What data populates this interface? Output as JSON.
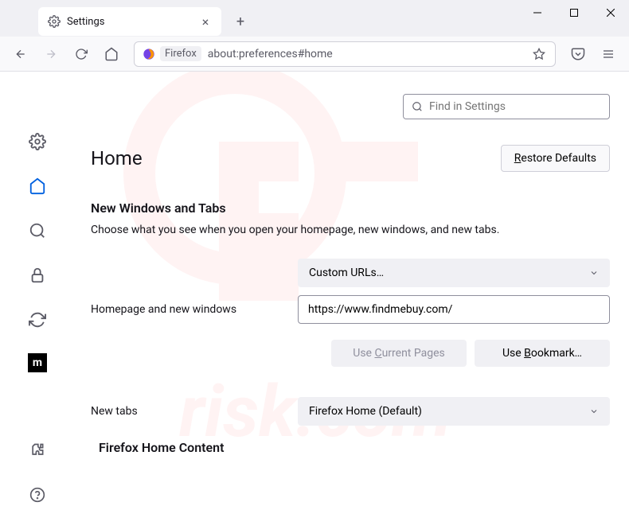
{
  "tab": {
    "title": "Settings"
  },
  "urlbar": {
    "identity_label": "Firefox",
    "url": "about:preferences#home"
  },
  "search": {
    "placeholder": "Find in Settings"
  },
  "page": {
    "heading": "Home",
    "restore_defaults": "Restore Defaults"
  },
  "section_windows": {
    "title": "New Windows and Tabs",
    "description": "Choose what you see when you open your homepage, new windows, and new tabs."
  },
  "homepage": {
    "label": "Homepage and new windows",
    "dropdown_value": "Custom URLs…",
    "url_value": "https://www.findmebuy.com/",
    "use_current": "Use Current Pages",
    "use_bookmark": "Use Bookmark…"
  },
  "newtabs": {
    "label": "New tabs",
    "dropdown_value": "Firefox Home (Default)"
  },
  "section_home_content": {
    "title": "Firefox Home Content"
  }
}
